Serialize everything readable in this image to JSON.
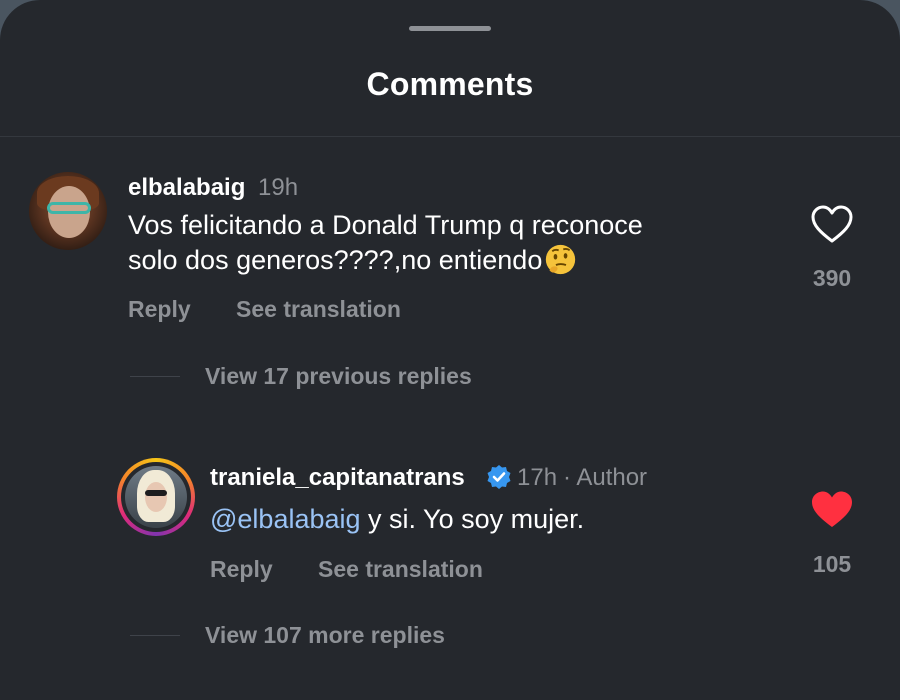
{
  "sheet": {
    "title": "Comments"
  },
  "comments": [
    {
      "username": "elbalabaig",
      "time": "19h",
      "text_line1": "Vos felicitando a Donald Trump q reconoce",
      "text_line2": "solo dos generos????,no entiendo",
      "emoji": "thinking-face-icon",
      "like_count": "390",
      "liked": false,
      "reply_label": "Reply",
      "translate_label": "See translation",
      "view_replies_label": "View 17 previous replies"
    },
    {
      "username": "traniela_capitanatrans",
      "verified": true,
      "time": "17h",
      "author_tag": "· Author",
      "mention": "@elbalabaig",
      "text": " y si. Yo soy mujer.",
      "like_count": "105",
      "liked": true,
      "reply_label": "Reply",
      "translate_label": "See translation",
      "view_replies_label": "View 107 more replies"
    }
  ],
  "colors": {
    "sheet_bg": "#25282d",
    "text_primary": "#ffffff",
    "text_secondary": "#8e9196",
    "mention": "#9ac3f5",
    "like_active": "#ff3040",
    "verified": "#3797f0"
  }
}
